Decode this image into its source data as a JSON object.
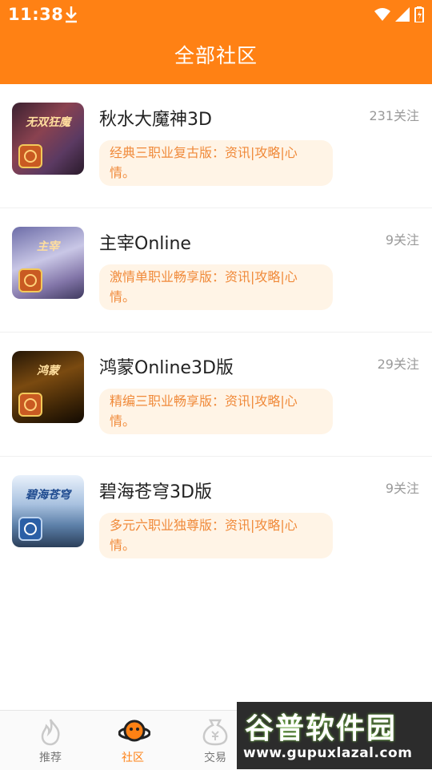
{
  "status_bar": {
    "time": "11:38",
    "icons": [
      "download-icon",
      "wifi-icon",
      "signal-icon",
      "battery-icon"
    ]
  },
  "header": {
    "title": "全部社区"
  },
  "communities": [
    {
      "name": "秋水大魔神3D",
      "follows": "231关注",
      "description": "经典三职业复古版：资讯|攻略|心情。",
      "thumb_caption": "无双狂魔"
    },
    {
      "name": "主宰Online",
      "follows": "9关注",
      "description": "激情单职业畅享版：资讯|攻略|心情。",
      "thumb_caption": "主宰"
    },
    {
      "name": "鸿蒙Online3D版",
      "follows": "29关注",
      "description": "精编三职业畅享版：资讯|攻略|心情。",
      "thumb_caption": "鸿蒙"
    },
    {
      "name": "碧海苍穹3D版",
      "follows": "9关注",
      "description": "多元六职业独尊版：资讯|攻略|心情。",
      "thumb_caption": "碧海苍穹"
    }
  ],
  "tabbar": {
    "tabs": [
      {
        "label": "推荐",
        "icon": "flame-icon",
        "active": false
      },
      {
        "label": "社区",
        "icon": "planet-icon",
        "active": true
      },
      {
        "label": "交易",
        "icon": "money-bag-icon",
        "active": false
      }
    ]
  },
  "watermark": {
    "title": "谷普软件园",
    "url": "www.gupuxlazal.com"
  },
  "colors": {
    "accent": "#ff8114",
    "desc_bg": "#fff4e6",
    "desc_text": "#f08a3a"
  }
}
